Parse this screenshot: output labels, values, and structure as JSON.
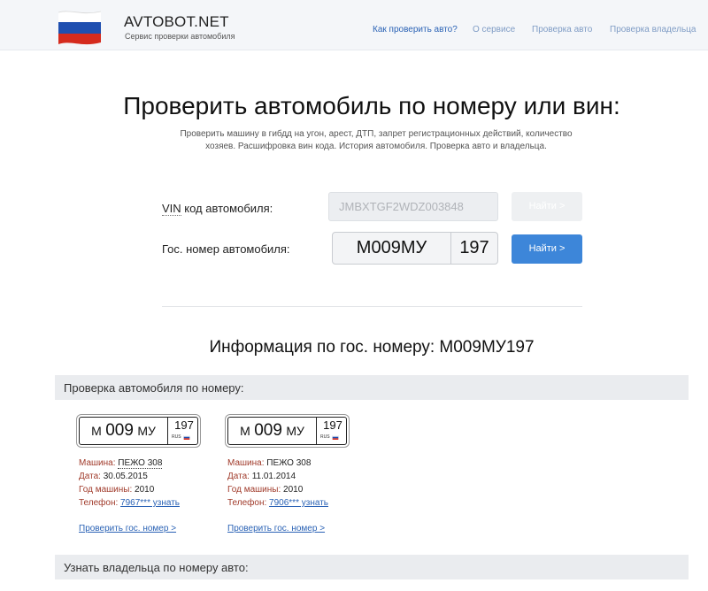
{
  "header": {
    "brand_title": "AVTOBOT.NET",
    "brand_subtitle": "Сервис проверки автомобиля",
    "nav": [
      {
        "label": "Как проверить авто?",
        "active": true
      },
      {
        "label": "О сервисе",
        "active": false
      },
      {
        "label": "Проверка авто",
        "active": false
      },
      {
        "label": "Проверка владельца",
        "active": false
      }
    ],
    "flag_colors": [
      "#ffffff",
      "#1f4fb0",
      "#d52b1e"
    ]
  },
  "hero": {
    "title": "Проверить автомобиль по номеру или вин:",
    "desc_line1": "Проверить машину в гибдд на угон, арест, ДТП, запрет регистрационных действий, количество",
    "desc_line2": "хозяев. Расшифровка вин кода. История автомобиля. Проверка авто и владельца."
  },
  "form": {
    "vin_abbr": "VIN",
    "vin_label_rest": " код автомобиля:",
    "vin_value": "JMBXTGF2WDZ003848",
    "vin_button": "Найти >",
    "plate_label": "Гос. номер автомобиля:",
    "plate_number": "М009МУ",
    "plate_region": "197",
    "plate_button": "Найти >"
  },
  "info": {
    "title": "Информация по гос. номеру: М009МУ197"
  },
  "section_check": {
    "title": "Проверка автомобиля по номеру:",
    "cards": [
      {
        "plate_letter1": "М",
        "plate_digits": "009",
        "plate_letters2": "МУ",
        "plate_region": "197",
        "plate_country": "RUS",
        "car_label": "Машина:",
        "car_value": "ПЕЖО 308",
        "date_label": "Дата:",
        "date_value": "30.05.2015",
        "year_label": "Год машины:",
        "year_value": "2010",
        "phone_label": "Телефон:",
        "phone_value": "7967*** узнать",
        "check_link": "Проверить гос. номер >"
      },
      {
        "plate_letter1": "М",
        "plate_digits": "009",
        "plate_letters2": "МУ",
        "plate_region": "197",
        "plate_country": "RUS",
        "car_label": "Машина:",
        "car_value": "ПЕЖО 308",
        "date_label": "Дата:",
        "date_value": "11.01.2014",
        "year_label": "Год машины:",
        "year_value": "2010",
        "phone_label": "Телефон:",
        "phone_value": "7906*** узнать",
        "check_link": "Проверить гос. номер >"
      }
    ]
  },
  "section_owner": {
    "title": "Узнать владельца по номеру авто:"
  },
  "colors": {
    "accent": "#3d86d9",
    "link": "#2a62b5",
    "label_red": "#a03a2a"
  }
}
